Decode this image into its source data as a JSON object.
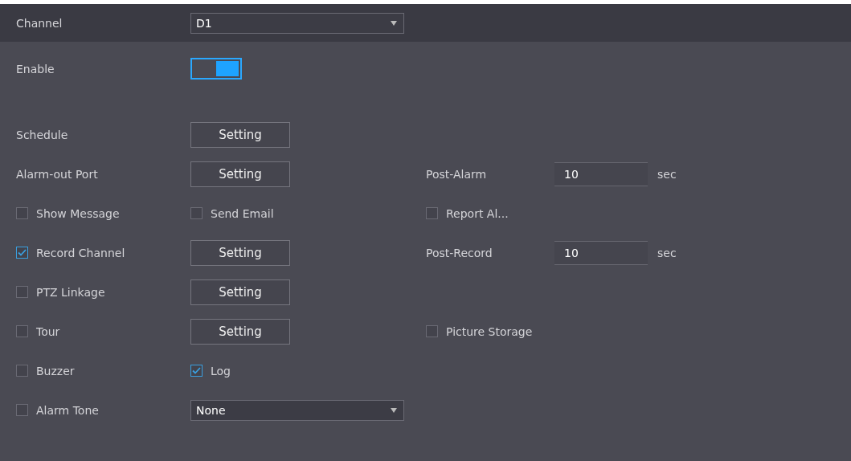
{
  "channel": {
    "label": "Channel",
    "value": "D1"
  },
  "enable": {
    "label": "Enable",
    "on": true
  },
  "rows": [
    {
      "cells": [
        {
          "kind": "label",
          "text": "Schedule"
        },
        {
          "kind": "button",
          "text": "Setting"
        }
      ]
    },
    {
      "cells": [
        {
          "kind": "label",
          "text": "Alarm-out Port"
        },
        {
          "kind": "button",
          "text": "Setting"
        },
        {
          "kind": "label",
          "text": "Post-Alarm"
        },
        {
          "kind": "field",
          "value": "10",
          "unit": "sec"
        }
      ]
    },
    {
      "cells": [
        {
          "kind": "checkbox",
          "text": "Show Message",
          "checked": false
        },
        {
          "kind": "checkbox",
          "text": "Send Email",
          "checked": false
        },
        {
          "kind": "checkbox",
          "text": "Report Al...",
          "checked": false
        }
      ]
    },
    {
      "cells": [
        {
          "kind": "checkbox",
          "text": "Record Channel",
          "checked": true
        },
        {
          "kind": "button",
          "text": "Setting"
        },
        {
          "kind": "label",
          "text": "Post-Record"
        },
        {
          "kind": "field",
          "value": "10",
          "unit": "sec"
        }
      ]
    },
    {
      "cells": [
        {
          "kind": "checkbox",
          "text": "PTZ Linkage",
          "checked": false
        },
        {
          "kind": "button",
          "text": "Setting"
        }
      ]
    },
    {
      "cells": [
        {
          "kind": "checkbox",
          "text": "Tour",
          "checked": false
        },
        {
          "kind": "button",
          "text": "Setting"
        },
        {
          "kind": "checkbox",
          "text": "Picture Storage",
          "checked": false
        }
      ]
    },
    {
      "cells": [
        {
          "kind": "checkbox",
          "text": "Buzzer",
          "checked": false
        },
        {
          "kind": "checkbox",
          "text": "Log",
          "checked": true
        }
      ]
    },
    {
      "cells": [
        {
          "kind": "checkbox",
          "text": "Alarm Tone",
          "checked": false
        },
        {
          "kind": "select",
          "value": "None"
        }
      ]
    }
  ]
}
